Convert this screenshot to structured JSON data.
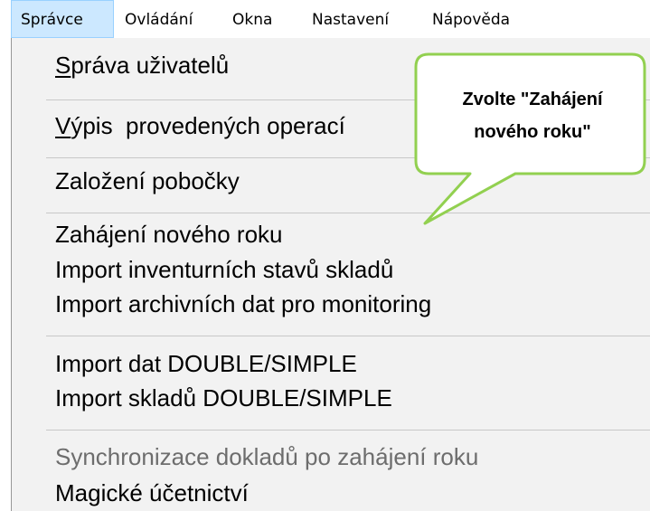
{
  "menubar": {
    "items": [
      {
        "label": "Správce"
      },
      {
        "label": "Ovládání"
      },
      {
        "label": "Okna"
      },
      {
        "label": "Nastavení"
      },
      {
        "label": "Nápověda"
      }
    ]
  },
  "dropdown": {
    "items": [
      {
        "label_first": "S",
        "label_rest": "práva uživatelů"
      },
      {
        "label_first": "V",
        "label_rest": "ýpis  provedených operací"
      },
      {
        "label": "Založení pobočky"
      },
      {
        "label": "Zahájení nového roku"
      },
      {
        "label": "Import inventurních stavů skladů"
      },
      {
        "label": "Import archivních dat pro monitoring"
      },
      {
        "label": "Import dat DOUBLE/SIMPLE"
      },
      {
        "label": "Import skladů DOUBLE/SIMPLE"
      },
      {
        "label": "Synchronizace dokladů po zahájení roku",
        "disabled": true
      },
      {
        "label": "Magické účetnictví"
      }
    ]
  },
  "callout": {
    "line1": "Zvolte \"Zahájení",
    "line2": "nového roku\"",
    "color": "#92d050"
  }
}
